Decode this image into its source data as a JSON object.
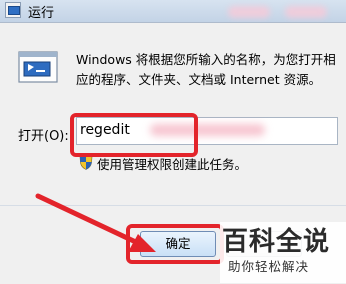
{
  "window": {
    "title": "运行"
  },
  "dialog": {
    "description": "Windows 将根据您所输入的名称，为您打开相应的程序、文件夹、文档或 Internet 资源。",
    "open_label": "打开(O):",
    "command_value": "regedit",
    "admin_note": "使用管理权限创建此任务。"
  },
  "buttons": {
    "ok_label": "确定"
  },
  "watermark": {
    "title": "百科全说",
    "subtitle": "助你轻松解决"
  },
  "colors": {
    "annotation": "#e3242b",
    "title_bar": "#c9d7e6",
    "panel": "#f0f0f0"
  },
  "icons": {
    "app": "run-dialog-icon",
    "run": "run-program-icon",
    "shield": "uac-shield-icon"
  }
}
